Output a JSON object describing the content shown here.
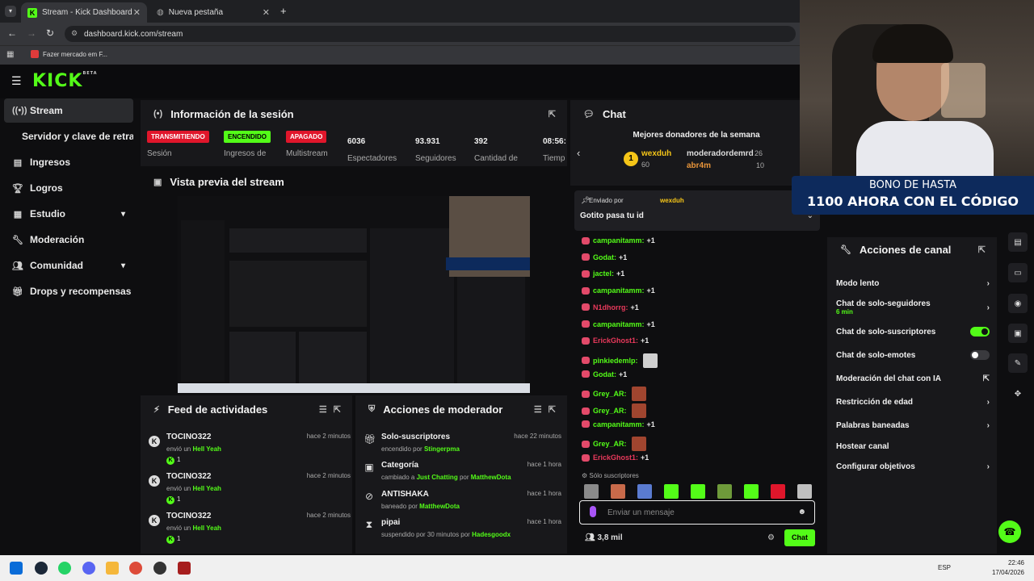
{
  "browser": {
    "tabs": [
      {
        "label": "Stream - Kick Dashboard",
        "active": true
      },
      {
        "label": "Nueva pestaña",
        "active": false
      }
    ],
    "url": "dashboard.kick.com/stream",
    "bookmark": "Fazer mercado em F..."
  },
  "kick": {
    "logo": "KICK",
    "beta": "BETA"
  },
  "sidebar": {
    "items": [
      {
        "label": "Stream",
        "icon": "broadcast-icon"
      },
      {
        "label": "Servidor y clave de retransmisión",
        "icon": "key-icon"
      },
      {
        "label": "Ingresos",
        "icon": "chart-icon"
      },
      {
        "label": "Logros",
        "icon": "trophy-icon"
      },
      {
        "label": "Estudio",
        "icon": "layout-icon"
      },
      {
        "label": "Moderación",
        "icon": "wrench-icon"
      },
      {
        "label": "Comunidad",
        "icon": "users-icon"
      },
      {
        "label": "Drops y recompensas",
        "icon": "gift-icon"
      }
    ]
  },
  "session": {
    "title": "Información de la sesión",
    "stats": [
      {
        "badge": "TRANSMITIENDO",
        "label": "Sesión"
      },
      {
        "badge": "ENCENDIDO",
        "label": "Ingresos de"
      },
      {
        "badge": "APAGADO",
        "label": "Multistream"
      },
      {
        "value": "6036",
        "label": "Espectadores"
      },
      {
        "value": "93.931",
        "label": "Seguidores"
      },
      {
        "value": "392",
        "label": "Cantidad de"
      },
      {
        "value": "08:56:",
        "label": "Tiemp"
      }
    ]
  },
  "preview": {
    "title": "Vista previa del stream"
  },
  "feed": {
    "title": "Feed de actividades",
    "items": [
      {
        "user": "TOCINO322",
        "text": "envió un",
        "item": "Hell Yeah",
        "count": "1",
        "time": "hace 2 minutos"
      },
      {
        "user": "TOCINO322",
        "text": "envió un",
        "item": "Hell Yeah",
        "count": "1",
        "time": "hace 2 minutos"
      },
      {
        "user": "TOCINO322",
        "text": "envió un",
        "item": "Hell Yeah",
        "count": "1",
        "time": "hace 2 minutos"
      }
    ]
  },
  "mod": {
    "title": "Acciones de moderador",
    "items": [
      {
        "title": "Solo-suscriptores",
        "pre": "encendido por",
        "who": "Stingerpma",
        "time": "hace 22 minutos",
        "icon": "gift-icon"
      },
      {
        "title": "Categoría",
        "pre": "cambiado a",
        "mid": "Just Chatting",
        "pre2": "por",
        "who": "MatthewDota",
        "time": "hace 1 hora",
        "icon": "category-icon"
      },
      {
        "title": "ANTISHAKA",
        "pre": "baneado por",
        "who": "MatthewDota",
        "time": "hace 1 hora",
        "icon": "ban-icon"
      },
      {
        "title": "pipai",
        "pre": "suspendido por 30 minutos por",
        "who": "Hadesgoodx",
        "time": "hace 1 hora",
        "icon": "hourglass-icon"
      }
    ]
  },
  "chat": {
    "title": "Chat",
    "donors_title": "Mejores donadores de la semana",
    "donors": [
      {
        "name": "wexduh",
        "amount": "60"
      },
      {
        "name": "moderadordemrd",
        "amount": "26"
      },
      {
        "name": "abr4m",
        "amount": "10"
      }
    ],
    "pinned_by": "Enviado por",
    "pinned_user": "wexduh",
    "pinned_msg": "Gotito pasa tu id",
    "messages": [
      {
        "user": "campanitamm:",
        "text": "+1",
        "color": "#53fc18"
      },
      {
        "user": "Godat:",
        "text": "+1",
        "color": "#53fc18"
      },
      {
        "user": "jactel:",
        "text": "+1",
        "color": "#53fc18"
      },
      {
        "user": "campanitamm:",
        "text": "+1",
        "color": "#53fc18"
      },
      {
        "user": "N1dhorrg:",
        "text": "+1",
        "color": "#e8395b"
      },
      {
        "user": "campanitamm:",
        "text": "+1",
        "color": "#53fc18"
      },
      {
        "user": "ErickGhost1:",
        "text": "+1",
        "color": "#e8395b"
      },
      {
        "user": "pinkiedemlp:",
        "text": "",
        "color": "#53fc18"
      },
      {
        "user": "Godat:",
        "text": "+1",
        "color": "#53fc18"
      },
      {
        "user": "Grey_AR:",
        "text": "",
        "color": "#53fc18"
      },
      {
        "user": "Grey_AR:",
        "text": "",
        "color": "#53fc18"
      },
      {
        "user": "campanitamm:",
        "text": "+1",
        "color": "#53fc18"
      },
      {
        "user": "Grey_AR:",
        "text": "",
        "color": "#53fc18"
      },
      {
        "user": "ErickGhost1:",
        "text": "+1",
        "color": "#e8395b"
      }
    ],
    "subs_only": "Sólo suscriptores",
    "input_placeholder": "Enviar un mensaje",
    "viewers": "3,8 mil",
    "send": "Chat"
  },
  "channel_actions": {
    "title": "Acciones de canal",
    "items": [
      {
        "label": "Modo lento",
        "type": "arrow"
      },
      {
        "label": "Chat de solo-seguidores",
        "sub": "6 min",
        "type": "arrow"
      },
      {
        "label": "Chat de solo-suscriptores",
        "type": "toggle",
        "on": true
      },
      {
        "label": "Chat de solo-emotes",
        "type": "toggle",
        "on": false
      },
      {
        "label": "Moderación del chat con IA",
        "type": "external"
      },
      {
        "label": "Restricción de edad",
        "type": "arrow"
      },
      {
        "label": "Palabras baneadas",
        "type": "arrow"
      },
      {
        "label": "Hostear canal",
        "type": "none"
      },
      {
        "label": "Configurar objetivos",
        "type": "arrow"
      }
    ]
  },
  "overlay": {
    "line1": "BONO DE HASTA",
    "line2": "1100 AHORA CON EL CÓDIGO"
  },
  "taskbar": {
    "lang": "ESP",
    "time": "22:46",
    "date": "17/04/2026"
  },
  "colors": {
    "accent": "#53fc18",
    "live_red": "#e0162b",
    "panel": "#18181b"
  }
}
